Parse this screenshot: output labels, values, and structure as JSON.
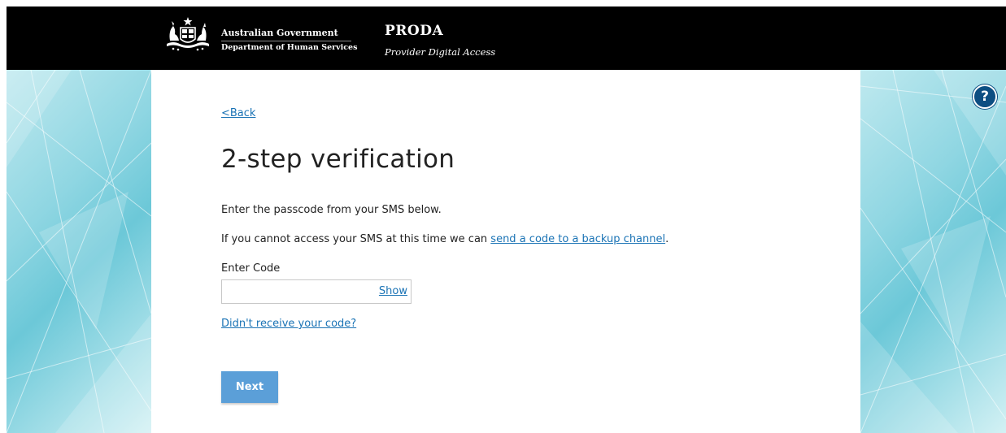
{
  "header": {
    "gov_line1": "Australian Government",
    "gov_line2": "Department of Human Services",
    "app_title": "PRODA",
    "app_subtitle": "Provider Digital Access",
    "crest_icon": "commonwealth-coat-of-arms-icon"
  },
  "help": {
    "icon": "question-mark-icon",
    "label": "?"
  },
  "main": {
    "back_label": "<Back",
    "title": "2-step verification",
    "instruction": "Enter the passcode from your SMS below.",
    "backup_prefix": "If you cannot access your SMS at this time we can ",
    "backup_link": "send a code to a backup channel",
    "backup_suffix": ".",
    "code_label": "Enter Code",
    "code_value": "",
    "show_label": "Show",
    "resend_link": "Didn't receive your code?",
    "next_label": "Next"
  },
  "colors": {
    "header_bg": "#000000",
    "link": "#1a73b5",
    "button": "#5b9fd8",
    "help": "#0d4e82",
    "background_teal": "#6cc8d8"
  }
}
